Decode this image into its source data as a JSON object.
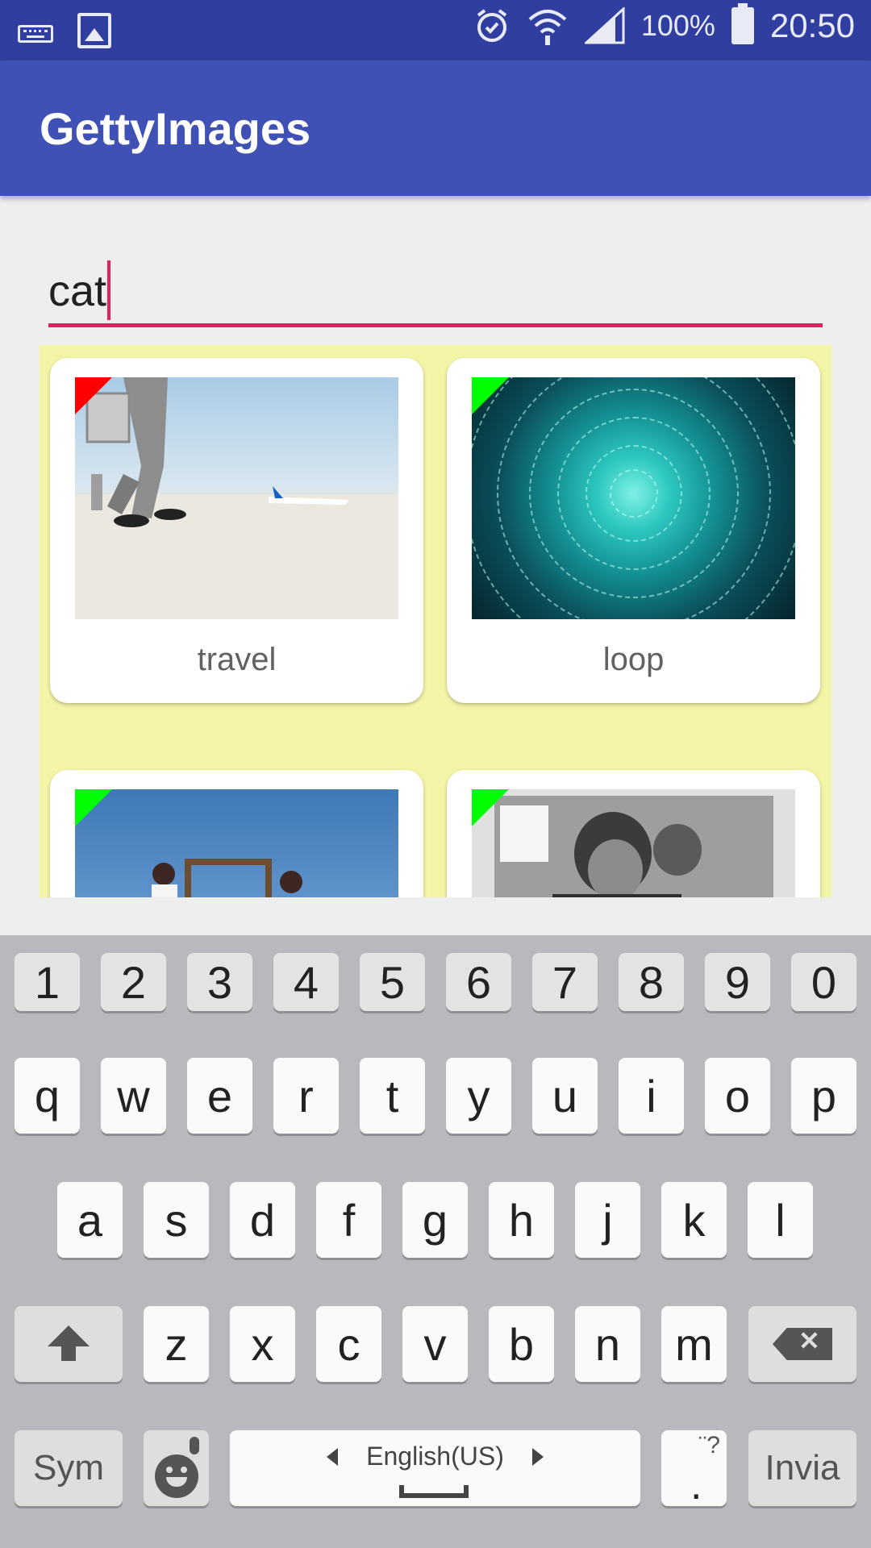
{
  "status_bar": {
    "icons_left": [
      "keyboard-icon",
      "gallery-icon"
    ],
    "icons_right": [
      "alarm-icon",
      "wifi-icon",
      "signal-icon",
      "battery-icon"
    ],
    "battery": "100%",
    "time": "20:50"
  },
  "app_bar": {
    "title": "GettyImages"
  },
  "search": {
    "value": "cat"
  },
  "grid": {
    "cards": [
      {
        "caption": "travel",
        "marker_color": "#ff0000"
      },
      {
        "caption": "loop",
        "marker_color": "#00ff00"
      },
      {
        "caption": "",
        "marker_color": "#00ff00"
      },
      {
        "caption": "",
        "marker_color": "#00ff00"
      }
    ]
  },
  "keyboard": {
    "number_row": [
      "1",
      "2",
      "3",
      "4",
      "5",
      "6",
      "7",
      "8",
      "9",
      "0"
    ],
    "row1": [
      "q",
      "w",
      "e",
      "r",
      "t",
      "y",
      "u",
      "i",
      "o",
      "p"
    ],
    "row2": [
      "a",
      "s",
      "d",
      "f",
      "g",
      "h",
      "j",
      "k",
      "l"
    ],
    "row3": [
      "z",
      "x",
      "c",
      "v",
      "b",
      "n",
      "m"
    ],
    "sym_label": "Sym",
    "space_label": "English(US)",
    "period_hint": "¨?",
    "period": ".",
    "enter_label": "Invia"
  },
  "colors": {
    "status_bar": "#303f9f",
    "app_bar": "#3f51b5",
    "accent": "#e91e63",
    "grid_background": "#f4f4a6"
  }
}
